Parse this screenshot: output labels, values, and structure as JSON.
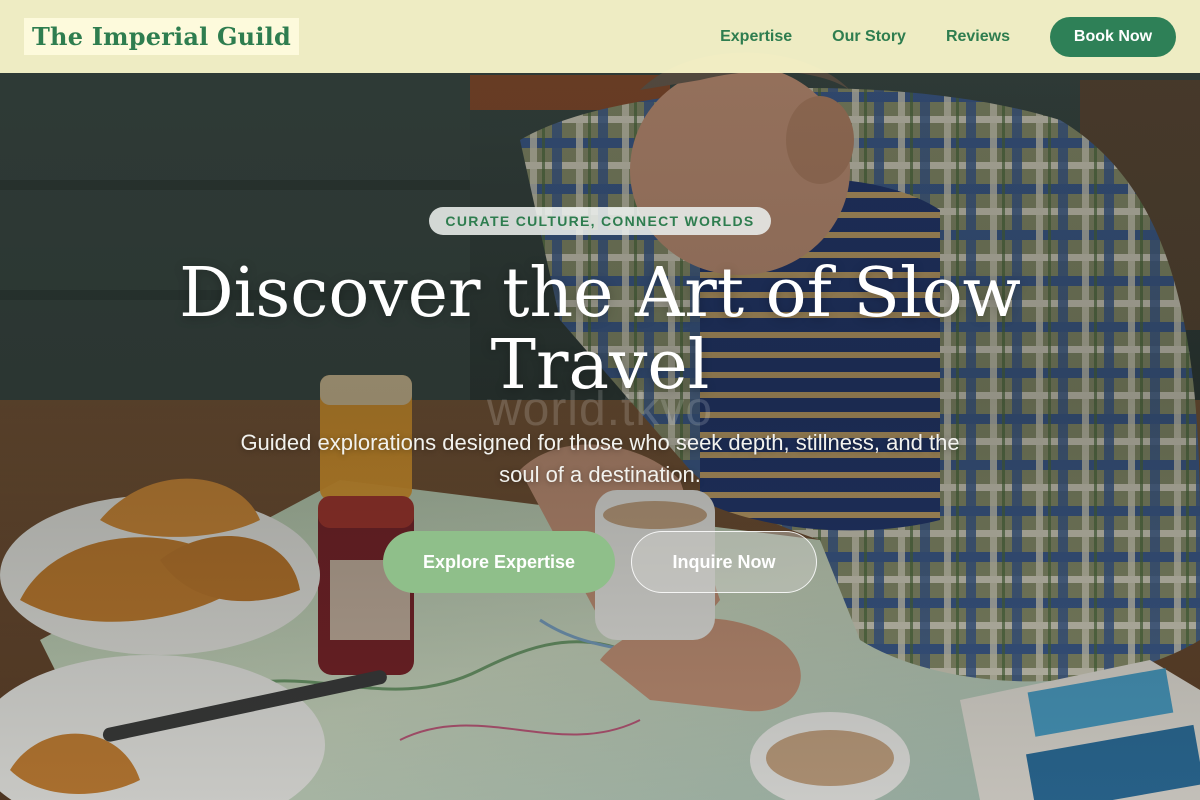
{
  "header": {
    "brand": "The Imperial Guild",
    "nav": [
      "Expertise",
      "Our Story",
      "Reviews"
    ],
    "cta": "Book Now"
  },
  "hero": {
    "tagline": "CURATE CULTURE, CONNECT WORLDS",
    "headline_line1": "Discover the Art of Slow",
    "headline_line2": "Travel",
    "watermark": "world.tkvo",
    "subtitle_line1": "Guided explorations designed for those who seek depth, stillness, and the",
    "subtitle_line2": "soul of a destination.",
    "primary_button": "Explore Expertise",
    "secondary_button": "Inquire Now",
    "image_subject": "man-reading-map-at-breakfast-table"
  },
  "colors": {
    "brand_green": "#2e7d4f",
    "header_bg": "#fdfacd",
    "button_dark_green": "#2e8057",
    "button_light_green": "#8fbf8a"
  }
}
